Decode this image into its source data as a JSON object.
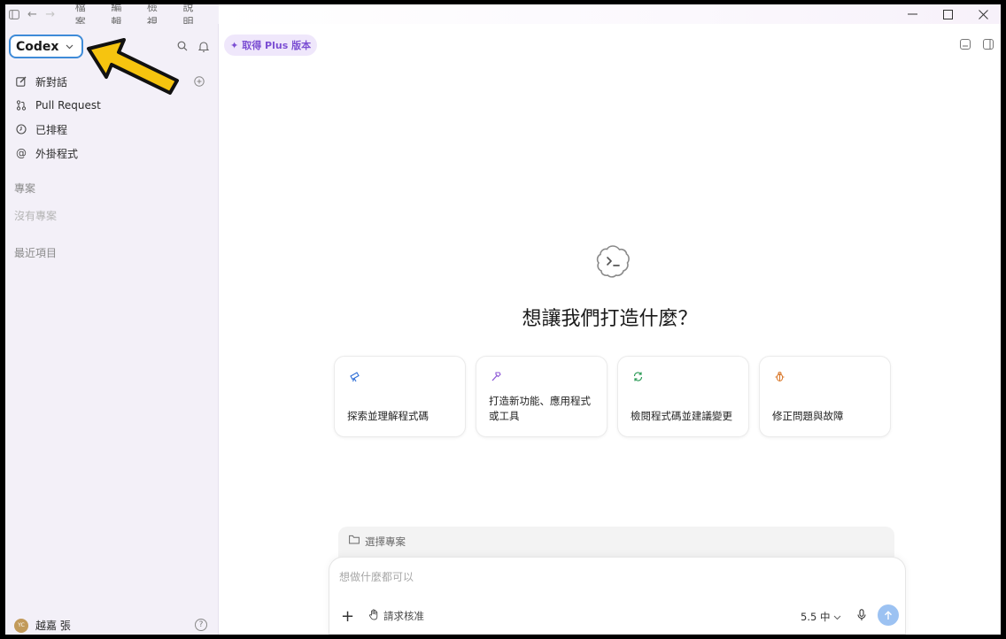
{
  "menu": [
    "檔案",
    "編輯",
    "檢視",
    "說明"
  ],
  "sidebar": {
    "brand": "Codex",
    "items": [
      {
        "label": "新對話",
        "icon": "edit-icon"
      },
      {
        "label": "Pull Request",
        "icon": "pull-request-icon"
      },
      {
        "label": "已排程",
        "icon": "clock-icon"
      },
      {
        "label": "外掛程式",
        "icon": "at-icon"
      }
    ],
    "projects_label": "專案",
    "projects_empty": "沒有專案",
    "recent_label": "最近項目",
    "user_name": "越嘉 張",
    "avatar_initials": "YC",
    "help_icon": "?"
  },
  "main": {
    "upgrade_label": "取得 Plus 版本",
    "headline": "想讓我們打造什麼？",
    "cards": [
      {
        "label": "探索並理解程式碼",
        "icon": "telescope-icon",
        "color": "#2f6fd6"
      },
      {
        "label": "打造新功能、應用程式或工具",
        "icon": "hammer-icon",
        "color": "#8b55d6"
      },
      {
        "label": "檢閱程式碼並建議變更",
        "icon": "refresh-icon",
        "color": "#2a9a55"
      },
      {
        "label": "修正問題與故障",
        "icon": "bug-icon",
        "color": "#d9782b"
      }
    ],
    "project_select": "選擇專案",
    "composer_placeholder": "想做什麼都可以",
    "approval_label": "請求核准",
    "model_label": "5.5 中"
  },
  "colors": {
    "accent": "#7c4fd3",
    "brand_outline": "#3e8bd8",
    "send_button": "#9cc2f2",
    "arrow_fill": "#f6c40f"
  }
}
